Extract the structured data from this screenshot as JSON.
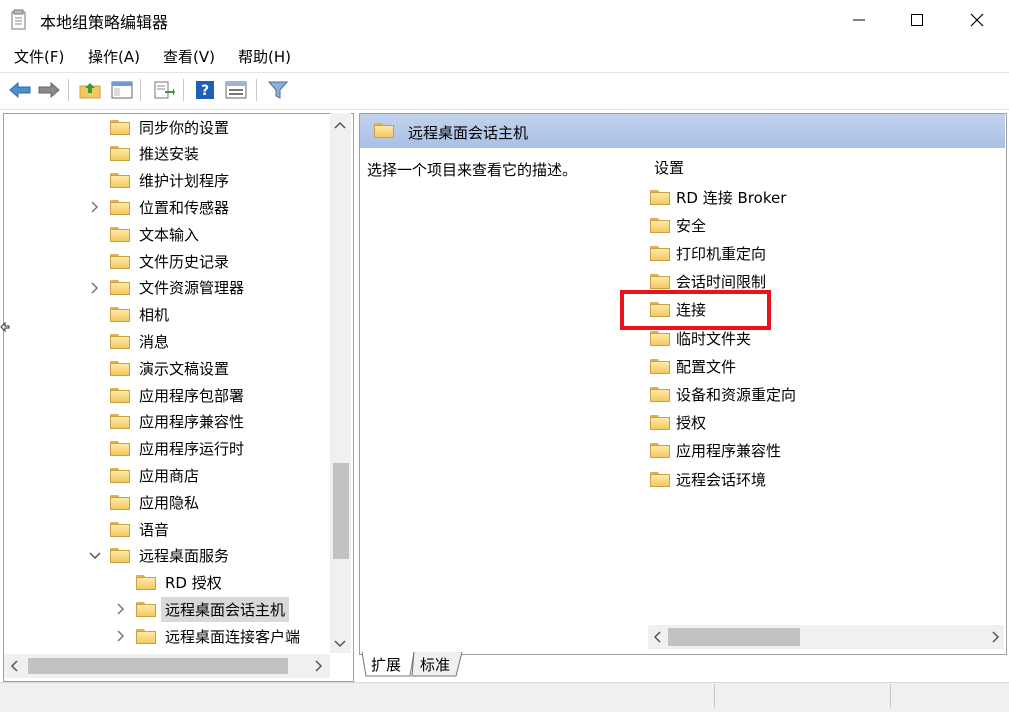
{
  "window": {
    "title": "本地组策略编辑器",
    "minimize_label": "—",
    "maximize_label": "☐",
    "close_label": "✕"
  },
  "menu": [
    "文件(F)",
    "操作(A)",
    "查看(V)",
    "帮助(H)"
  ],
  "toolbar": {
    "buttons": [
      "back-icon",
      "forward-icon",
      "up-folder-icon",
      "show-hide-tree-icon",
      "export-list-icon",
      "help-icon",
      "view-icon",
      "filter-icon"
    ]
  },
  "tree": {
    "items": [
      {
        "label": "同步你的设置",
        "expandable": false
      },
      {
        "label": "推送安装",
        "expandable": false
      },
      {
        "label": "维护计划程序",
        "expandable": false
      },
      {
        "label": "位置和传感器",
        "expandable": true
      },
      {
        "label": "文本输入",
        "expandable": false
      },
      {
        "label": "文件历史记录",
        "expandable": false
      },
      {
        "label": "文件资源管理器",
        "expandable": true
      },
      {
        "label": "相机",
        "expandable": false
      },
      {
        "label": "消息",
        "expandable": false
      },
      {
        "label": "演示文稿设置",
        "expandable": false
      },
      {
        "label": "应用程序包部署",
        "expandable": false
      },
      {
        "label": "应用程序兼容性",
        "expandable": false
      },
      {
        "label": "应用程序运行时",
        "expandable": false
      },
      {
        "label": "应用商店",
        "expandable": false
      },
      {
        "label": "应用隐私",
        "expandable": false
      },
      {
        "label": "语音",
        "expandable": false
      },
      {
        "label": "远程桌面服务",
        "expandable": true,
        "expanded": true
      },
      {
        "label": "RD 授权",
        "expandable": false,
        "child": true
      },
      {
        "label": "远程桌面会话主机",
        "expandable": true,
        "child": true,
        "selected": true
      },
      {
        "label": "远程桌面连接客户端",
        "expandable": true,
        "child": true
      }
    ]
  },
  "right": {
    "header_title": "远程桌面会话主机",
    "description": "选择一个项目来查看它的描述。",
    "settings_heading": "设置",
    "settings": [
      "RD 连接 Broker",
      "安全",
      "打印机重定向",
      "会话时间限制",
      "连接",
      "临时文件夹",
      "配置文件",
      "设备和资源重定向",
      "授权",
      "应用程序兼容性",
      "远程会话环境"
    ],
    "highlighted": "连接"
  },
  "tabs": [
    "扩展",
    "标准"
  ],
  "colors": {
    "highlight_border": "#e8141b",
    "header_bg": "#a9c0e6",
    "selected_bg": "#d9d9d9"
  }
}
